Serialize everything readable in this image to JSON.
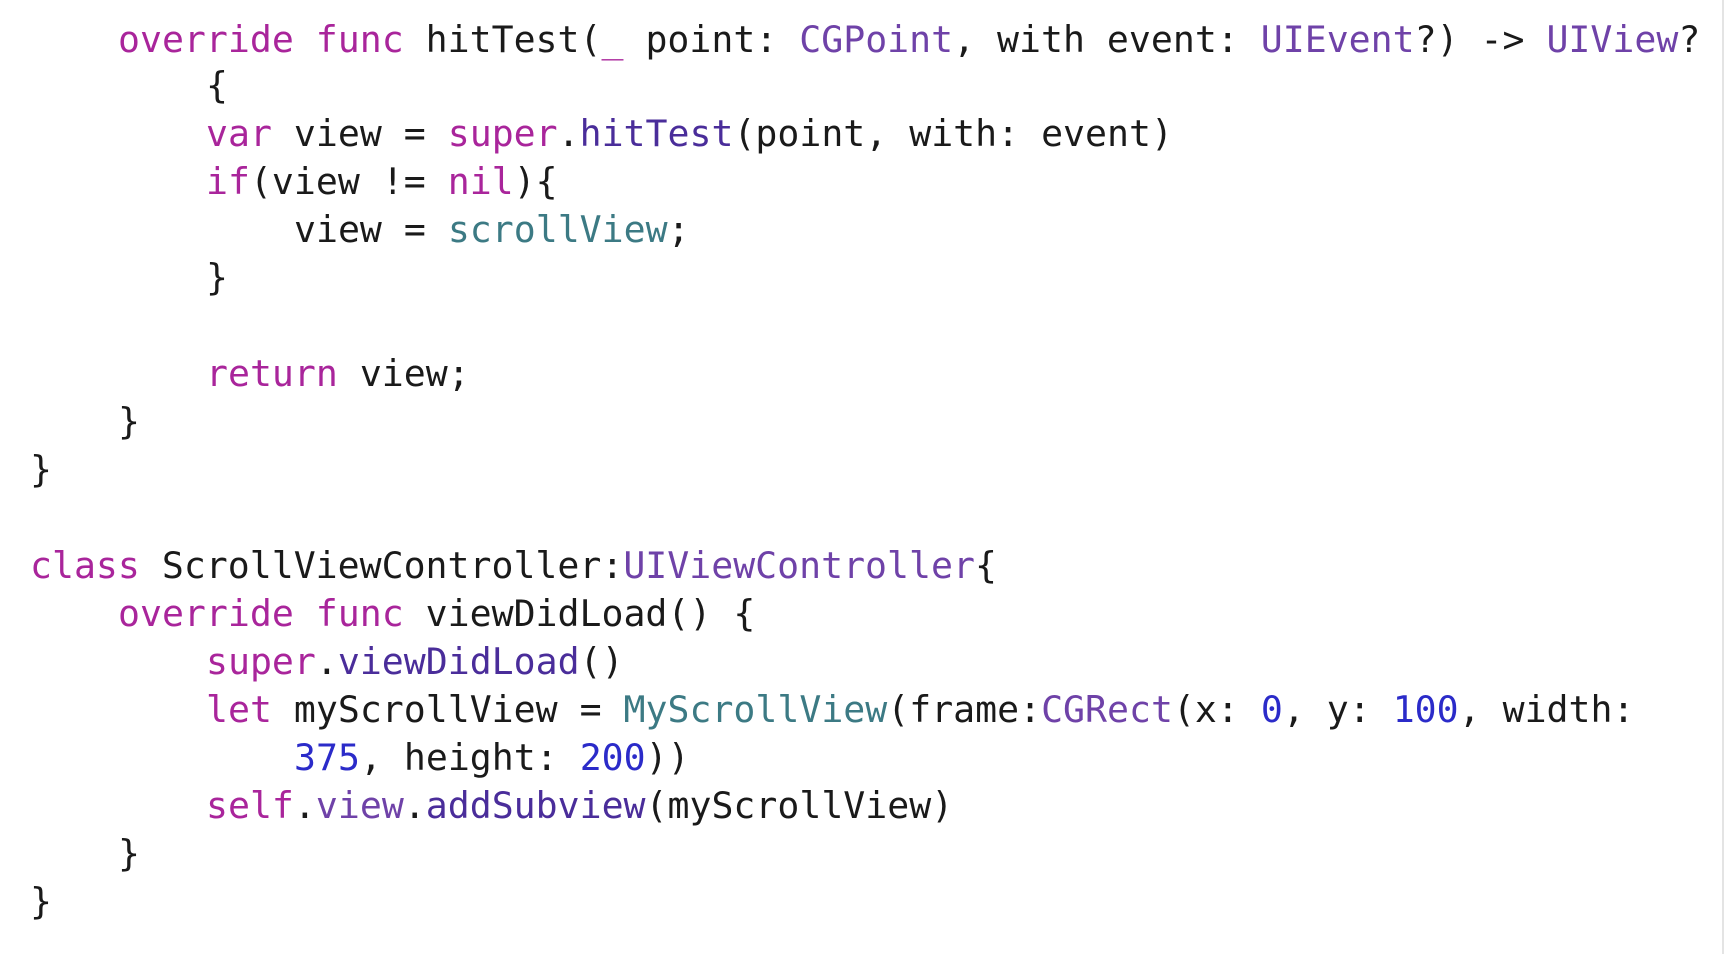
{
  "colors": {
    "keyword": "#a9259b",
    "type": "#6f42a8",
    "method": "#4a2d9a",
    "property": "#3c7a84",
    "number": "#2b2bc9",
    "plain": "#1a1a1a",
    "background": "#ffffff"
  },
  "lines": [
    {
      "name": "line-hittest-signature",
      "indent": 4,
      "tokens": [
        {
          "t": "override",
          "c": "kw"
        },
        {
          "t": " ",
          "c": "pl"
        },
        {
          "t": "func",
          "c": "kw"
        },
        {
          "t": " hitTest(",
          "c": "pl"
        },
        {
          "t": "_",
          "c": "kw"
        },
        {
          "t": " point: ",
          "c": "pl"
        },
        {
          "t": "CGPoint",
          "c": "ty"
        },
        {
          "t": ", with event: ",
          "c": "pl"
        },
        {
          "t": "UIEvent",
          "c": "ty"
        },
        {
          "t": "?) -> ",
          "c": "pl"
        },
        {
          "t": "UIView",
          "c": "ty"
        },
        {
          "t": "?",
          "c": "pl"
        }
      ]
    },
    {
      "name": "line-open-brace",
      "indent": 8,
      "tokens": [
        {
          "t": "{",
          "c": "pl"
        }
      ]
    },
    {
      "name": "line-var-view",
      "indent": 8,
      "tokens": [
        {
          "t": "var",
          "c": "kw"
        },
        {
          "t": " view = ",
          "c": "pl"
        },
        {
          "t": "super",
          "c": "kw"
        },
        {
          "t": ".",
          "c": "pl"
        },
        {
          "t": "hitTest",
          "c": "fn"
        },
        {
          "t": "(point, with: event)",
          "c": "pl"
        }
      ]
    },
    {
      "name": "line-if-view",
      "indent": 8,
      "tokens": [
        {
          "t": "if",
          "c": "kw"
        },
        {
          "t": "(view != ",
          "c": "pl"
        },
        {
          "t": "nil",
          "c": "kw"
        },
        {
          "t": "){",
          "c": "pl"
        }
      ]
    },
    {
      "name": "line-assign-scrollview",
      "indent": 12,
      "tokens": [
        {
          "t": "view = ",
          "c": "pl"
        },
        {
          "t": "scrollView",
          "c": "prop"
        },
        {
          "t": ";",
          "c": "pl"
        }
      ]
    },
    {
      "name": "line-close-if",
      "indent": 8,
      "tokens": [
        {
          "t": "}",
          "c": "pl"
        }
      ]
    },
    {
      "name": "line-blank-1",
      "indent": 0,
      "tokens": []
    },
    {
      "name": "line-return-view",
      "indent": 8,
      "tokens": [
        {
          "t": "return",
          "c": "kw"
        },
        {
          "t": " view;",
          "c": "pl"
        }
      ]
    },
    {
      "name": "line-close-func",
      "indent": 4,
      "tokens": [
        {
          "t": "}",
          "c": "pl"
        }
      ]
    },
    {
      "name": "line-close-class-1",
      "indent": 0,
      "tokens": [
        {
          "t": "}",
          "c": "pl"
        }
      ]
    },
    {
      "name": "line-blank-2",
      "indent": 0,
      "tokens": []
    },
    {
      "name": "line-class-decl",
      "indent": 0,
      "tokens": [
        {
          "t": "class",
          "c": "kw"
        },
        {
          "t": " ScrollViewController:",
          "c": "pl"
        },
        {
          "t": "UIViewController",
          "c": "ty"
        },
        {
          "t": "{",
          "c": "pl"
        }
      ]
    },
    {
      "name": "line-viewdidload-decl",
      "indent": 4,
      "tokens": [
        {
          "t": "override",
          "c": "kw"
        },
        {
          "t": " ",
          "c": "pl"
        },
        {
          "t": "func",
          "c": "kw"
        },
        {
          "t": " viewDidLoad() {",
          "c": "pl"
        }
      ]
    },
    {
      "name": "line-super-viewdidload",
      "indent": 8,
      "tokens": [
        {
          "t": "super",
          "c": "kw"
        },
        {
          "t": ".",
          "c": "pl"
        },
        {
          "t": "viewDidLoad",
          "c": "fn"
        },
        {
          "t": "()",
          "c": "pl"
        }
      ]
    },
    {
      "name": "line-let-myscrollview",
      "indent": 8,
      "tokens": [
        {
          "t": "let",
          "c": "kw"
        },
        {
          "t": " myScrollView = ",
          "c": "pl"
        },
        {
          "t": "MyScrollView",
          "c": "prop"
        },
        {
          "t": "(frame:",
          "c": "pl"
        },
        {
          "t": "CGRect",
          "c": "ty"
        },
        {
          "t": "(x: ",
          "c": "pl"
        },
        {
          "t": "0",
          "c": "num"
        },
        {
          "t": ", y: ",
          "c": "pl"
        },
        {
          "t": "100",
          "c": "num"
        },
        {
          "t": ", width:",
          "c": "pl"
        }
      ]
    },
    {
      "name": "line-let-myscrollview-cont",
      "indent": 12,
      "tokens": [
        {
          "t": "375",
          "c": "num"
        },
        {
          "t": ", height: ",
          "c": "pl"
        },
        {
          "t": "200",
          "c": "num"
        },
        {
          "t": "))",
          "c": "pl"
        }
      ]
    },
    {
      "name": "line-add-subview",
      "indent": 8,
      "tokens": [
        {
          "t": "self",
          "c": "kw"
        },
        {
          "t": ".",
          "c": "pl"
        },
        {
          "t": "view",
          "c": "ty"
        },
        {
          "t": ".",
          "c": "pl"
        },
        {
          "t": "addSubview",
          "c": "fn"
        },
        {
          "t": "(myScrollView)",
          "c": "pl"
        }
      ]
    },
    {
      "name": "line-close-viewdidload",
      "indent": 4,
      "tokens": [
        {
          "t": "}",
          "c": "pl"
        }
      ]
    },
    {
      "name": "line-close-class-2",
      "indent": 0,
      "tokens": [
        {
          "t": "}",
          "c": "pl"
        }
      ]
    }
  ]
}
